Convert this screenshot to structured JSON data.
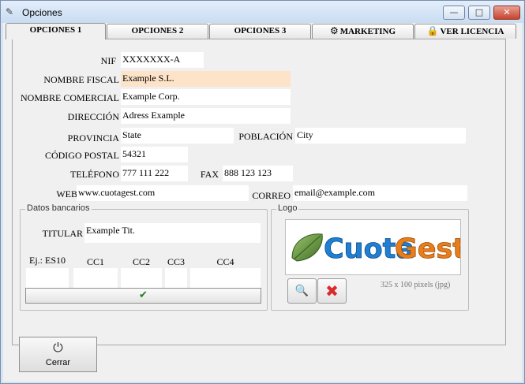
{
  "window": {
    "title": "Opciones",
    "minimize": "—",
    "maximize": "□",
    "close": "✕"
  },
  "tabs": [
    {
      "label": "OPCIONES 1",
      "icon": ""
    },
    {
      "label": "OPCIONES 2",
      "icon": ""
    },
    {
      "label": "OPCIONES 3",
      "icon": ""
    },
    {
      "label": "MARKETING",
      "icon": "gear-icon"
    },
    {
      "label": "VER LICENCIA",
      "icon": "lock-icon"
    }
  ],
  "form": {
    "nif": {
      "label": "NIF",
      "value": "XXXXXXX-A"
    },
    "nombre_fiscal": {
      "label": "NOMBRE FISCAL",
      "value": "Example S.L."
    },
    "nombre_comercial": {
      "label": "NOMBRE COMERCIAL",
      "value": "Example Corp."
    },
    "direccion": {
      "label": "DIRECCIÓN",
      "value": "Adress Example"
    },
    "provincia": {
      "label": "PROVINCIA",
      "value": "State"
    },
    "poblacion": {
      "label": "POBLACIÓN",
      "value": "City"
    },
    "codigo_postal": {
      "label": "CÓDIGO POSTAL",
      "value": "54321"
    },
    "telefono": {
      "label": "TELÉFONO",
      "value": "777 111 222"
    },
    "fax": {
      "label": "FAX",
      "value": "888 123 123"
    },
    "web": {
      "label": "WEB",
      "value": "www.cuotagest.com"
    },
    "correo": {
      "label": "CORREO",
      "value": "email@example.com"
    }
  },
  "bank": {
    "group_title": "Datos bancarios",
    "titular_label": "TITULAR",
    "titular_value": "Example Tit.",
    "iban_hint": "Ej.: ES10",
    "cc1": "CC1",
    "cc2": "CC2",
    "cc3": "CC3",
    "cc4": "CC4",
    "iban_value": "",
    "cc1_value": "",
    "cc2_value": "",
    "cc3_value": "",
    "cc4_value": "",
    "confirm_icon": "✔"
  },
  "logo": {
    "group_title": "Logo",
    "text_cuota": "Cuota",
    "text_gest": "Gest",
    "caption": "325 x 100 pixels (jpg)",
    "search_icon": "🔍",
    "delete_icon": "✖"
  },
  "footer": {
    "close_label": "Cerrar",
    "power_icon": "⏻"
  },
  "colors": {
    "highlight_field": "#fde3c8",
    "logo_blue": "#1f7fd3",
    "logo_orange": "#e97d1a",
    "delete_red": "#d92b2b",
    "check_green": "#1e7b23"
  }
}
